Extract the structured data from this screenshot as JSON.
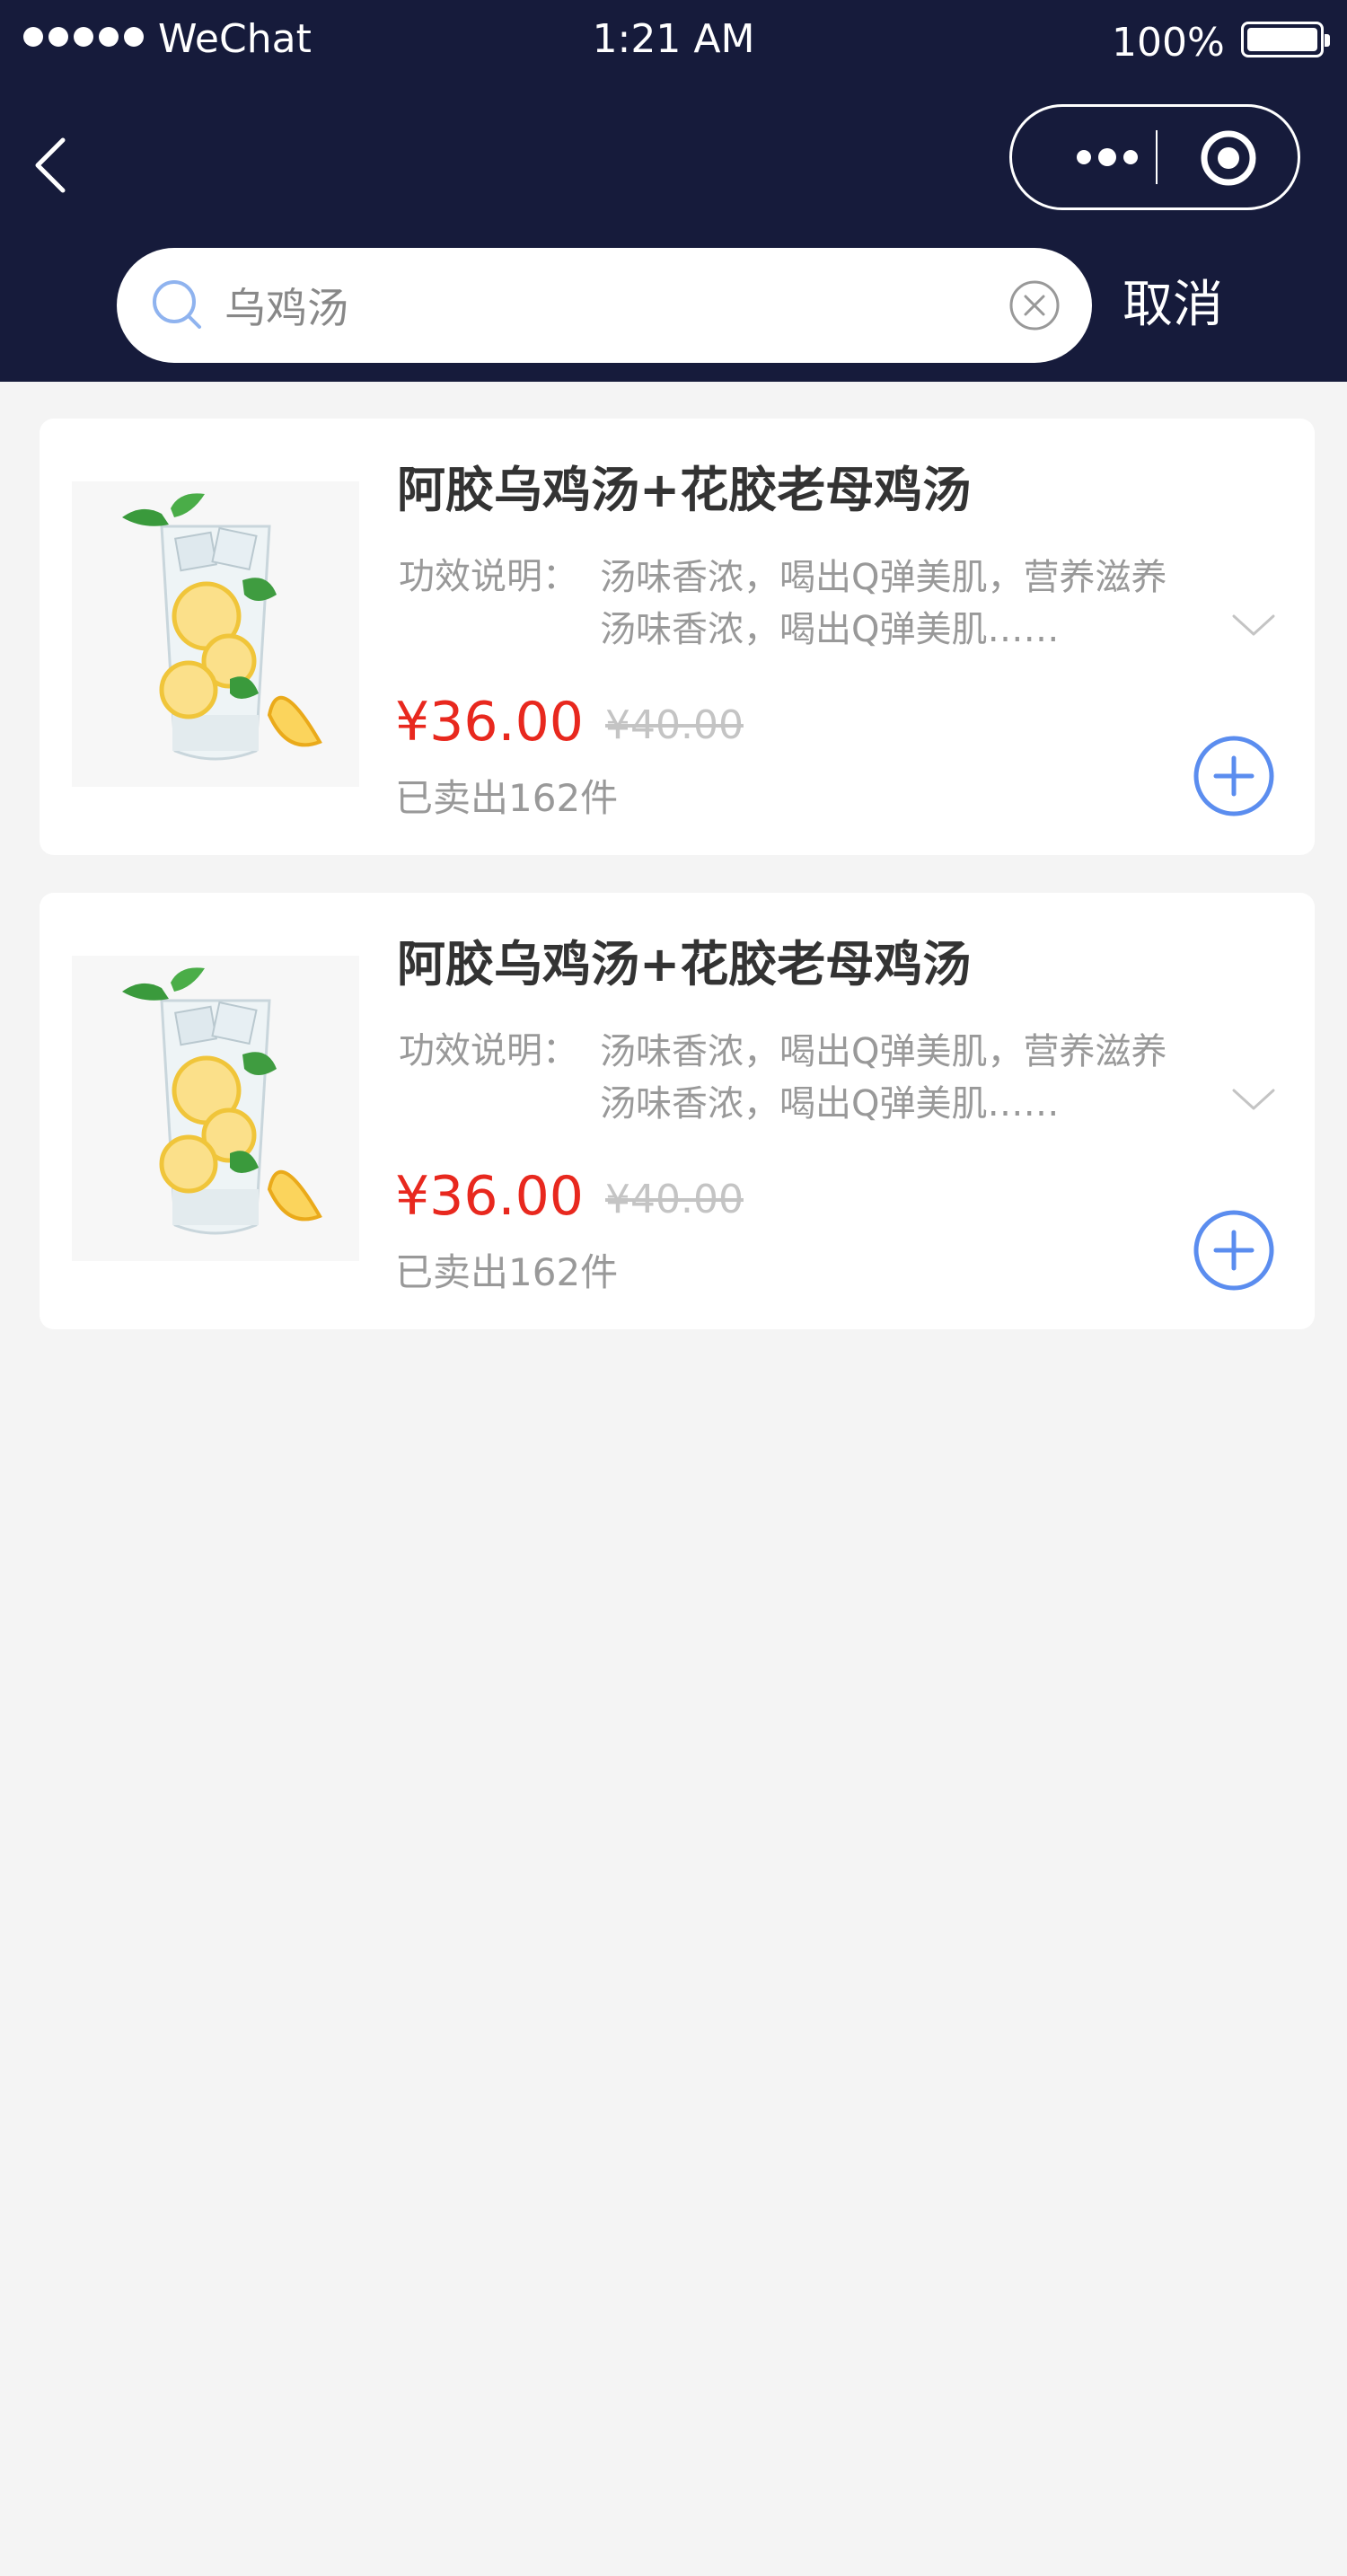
{
  "status_bar": {
    "carrier": "WeChat",
    "time": "1:21 AM",
    "battery_percent": "100%",
    "battery_level": 1.0
  },
  "search": {
    "value": "乌鸡汤",
    "cancel_label": "取消"
  },
  "products": [
    {
      "title": "阿胶乌鸡汤+花胶老母鸡汤",
      "desc_label": "功效说明：",
      "desc_line1": "汤味香浓，喝出Q弹美肌，营养滋养",
      "desc_line2": "汤味香浓，喝出Q弹美肌……",
      "price": "¥36.00",
      "old_price": "¥40.00",
      "sold": "已卖出162件"
    },
    {
      "title": "阿胶乌鸡汤+花胶老母鸡汤",
      "desc_label": "功效说明：",
      "desc_line1": "汤味香浓，喝出Q弹美肌，营养滋养",
      "desc_line2": "汤味香浓，喝出Q弹美肌……",
      "price": "¥36.00",
      "old_price": "¥40.00",
      "sold": "已卖出162件"
    }
  ],
  "colors": {
    "header_bg": "#161b3b",
    "price": "#e8281e",
    "accent": "#5b8def"
  }
}
